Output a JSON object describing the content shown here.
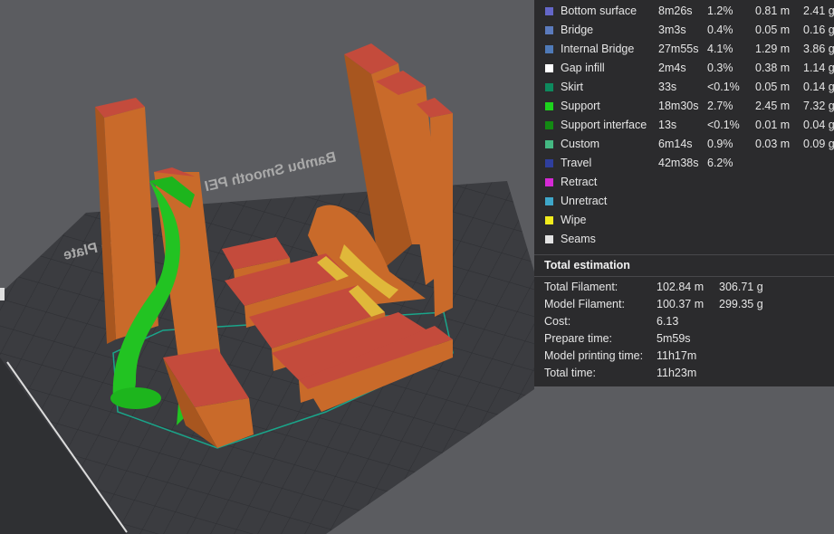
{
  "bed": {
    "label_mirrored": "Bambu Smooth PEI Plate",
    "label_left": "amp Plate"
  },
  "legend": {
    "rows": [
      {
        "name": "Bottom surface",
        "color": "#6467c9",
        "time": "8m26s",
        "pct": "1.2%",
        "len": "0.81 m",
        "wt": "2.41 g"
      },
      {
        "name": "Bridge",
        "color": "#5b7bbd",
        "time": "3m3s",
        "pct": "0.4%",
        "len": "0.05 m",
        "wt": "0.16 g"
      },
      {
        "name": "Internal Bridge",
        "color": "#4f7ab8",
        "time": "27m55s",
        "pct": "4.1%",
        "len": "1.29 m",
        "wt": "3.86 g"
      },
      {
        "name": "Gap infill",
        "color": "#ffffff",
        "time": "2m4s",
        "pct": "0.3%",
        "len": "0.38 m",
        "wt": "1.14 g"
      },
      {
        "name": "Skirt",
        "color": "#0e8a5e",
        "time": "33s",
        "pct": "<0.1%",
        "len": "0.05 m",
        "wt": "0.14 g"
      },
      {
        "name": "Support",
        "color": "#1dd31d",
        "time": "18m30s",
        "pct": "2.7%",
        "len": "2.45 m",
        "wt": "7.32 g"
      },
      {
        "name": "Support interface",
        "color": "#138a13",
        "time": "13s",
        "pct": "<0.1%",
        "len": "0.01 m",
        "wt": "0.04 g"
      },
      {
        "name": "Custom",
        "color": "#44b882",
        "time": "6m14s",
        "pct": "0.9%",
        "len": "0.03 m",
        "wt": "0.09 g"
      },
      {
        "name": "Travel",
        "color": "#2f3f9e",
        "time": "42m38s",
        "pct": "6.2%",
        "len": "",
        "wt": ""
      },
      {
        "name": "Retract",
        "color": "#d52ad5",
        "time": "",
        "pct": "",
        "len": "",
        "wt": ""
      },
      {
        "name": "Unretract",
        "color": "#3fa7c9",
        "time": "",
        "pct": "",
        "len": "",
        "wt": ""
      },
      {
        "name": "Wipe",
        "color": "#f1ec1d",
        "time": "",
        "pct": "",
        "len": "",
        "wt": ""
      },
      {
        "name": "Seams",
        "color": "#e3e3e3",
        "time": "",
        "pct": "",
        "len": "",
        "wt": ""
      }
    ]
  },
  "estimation": {
    "title": "Total estimation",
    "rows": [
      {
        "label": "Total Filament:",
        "v1": "102.84 m",
        "v2": "306.71 g"
      },
      {
        "label": "Model Filament:",
        "v1": "100.37 m",
        "v2": "299.35 g"
      },
      {
        "label": "Cost:",
        "v1": "6.13",
        "v2": ""
      },
      {
        "label": "Prepare time:",
        "v1": "5m59s",
        "v2": ""
      },
      {
        "label": "Model printing time:",
        "v1": "11h17m",
        "v2": ""
      },
      {
        "label": "Total time:",
        "v1": "11h23m",
        "v2": ""
      }
    ]
  }
}
